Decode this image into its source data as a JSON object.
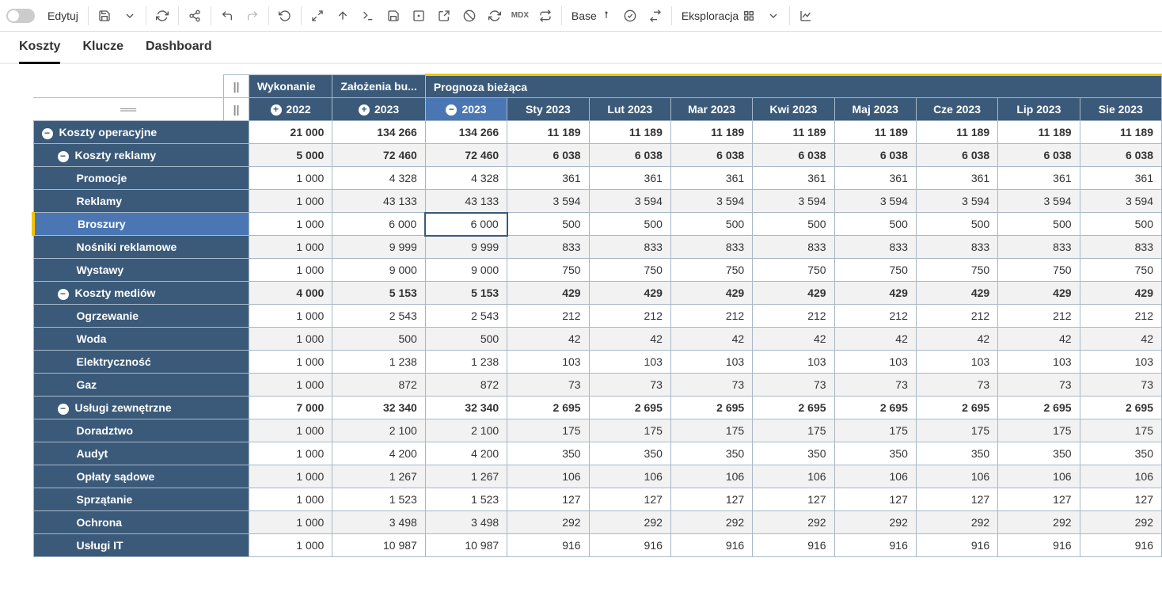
{
  "toolbar": {
    "edit_label": "Edytuj",
    "base_label": "Base",
    "exploration_label": "Eksploracja",
    "mdx_label": "MDX"
  },
  "tabs": [
    {
      "label": "Koszty",
      "active": true
    },
    {
      "label": "Klucze",
      "active": false
    },
    {
      "label": "Dashboard",
      "active": false
    }
  ],
  "pause_glyph": "||",
  "handle_glyph": "══",
  "top_headers": [
    {
      "label": "Wykonanie",
      "pm": null,
      "selected": false
    },
    {
      "label": "Założenia bu...",
      "pm": null,
      "selected": false
    },
    {
      "label": "Prognoza bieżąca",
      "pm": null,
      "selected": true,
      "span": 9
    }
  ],
  "sub_headers": [
    {
      "label": "2022",
      "pm": "+",
      "selected": false
    },
    {
      "label": "2023",
      "pm": "+",
      "selected": false
    },
    {
      "label": "2023",
      "pm": "−",
      "selected": true
    },
    {
      "label": "Sty 2023",
      "pm": null
    },
    {
      "label": "Lut 2023",
      "pm": null
    },
    {
      "label": "Mar 2023",
      "pm": null
    },
    {
      "label": "Kwi 2023",
      "pm": null
    },
    {
      "label": "Maj 2023",
      "pm": null
    },
    {
      "label": "Cze 2023",
      "pm": null
    },
    {
      "label": "Lip 2023",
      "pm": null
    },
    {
      "label": "Sie 2023",
      "pm": null
    }
  ],
  "rows": [
    {
      "label": "Koszty operacyjne",
      "indent": 0,
      "pm": "−",
      "bold": true,
      "alt": false,
      "vals": [
        "21 000",
        "134 266",
        "134 266",
        "11 189",
        "11 189",
        "11 189",
        "11 189",
        "11 189",
        "11 189",
        "11 189",
        "11 189"
      ]
    },
    {
      "label": "Koszty reklamy",
      "indent": 1,
      "pm": "−",
      "bold": true,
      "alt": true,
      "vals": [
        "5 000",
        "72 460",
        "72 460",
        "6 038",
        "6 038",
        "6 038",
        "6 038",
        "6 038",
        "6 038",
        "6 038",
        "6 038"
      ]
    },
    {
      "label": "Promocje",
      "indent": 2,
      "pm": null,
      "bold": false,
      "alt": false,
      "vals": [
        "1 000",
        "4 328",
        "4 328",
        "361",
        "361",
        "361",
        "361",
        "361",
        "361",
        "361",
        "361"
      ]
    },
    {
      "label": "Reklamy",
      "indent": 2,
      "pm": null,
      "bold": false,
      "alt": true,
      "vals": [
        "1 000",
        "43 133",
        "43 133",
        "3 594",
        "3 594",
        "3 594",
        "3 594",
        "3 594",
        "3 594",
        "3 594",
        "3 594"
      ]
    },
    {
      "label": "Broszury",
      "indent": 2,
      "pm": null,
      "bold": false,
      "alt": false,
      "selected": true,
      "selcol": 2,
      "vals": [
        "1 000",
        "6 000",
        "6 000",
        "500",
        "500",
        "500",
        "500",
        "500",
        "500",
        "500",
        "500"
      ]
    },
    {
      "label": "Nośniki reklamowe",
      "indent": 2,
      "pm": null,
      "bold": false,
      "alt": true,
      "vals": [
        "1 000",
        "9 999",
        "9 999",
        "833",
        "833",
        "833",
        "833",
        "833",
        "833",
        "833",
        "833"
      ]
    },
    {
      "label": "Wystawy",
      "indent": 2,
      "pm": null,
      "bold": false,
      "alt": false,
      "vals": [
        "1 000",
        "9 000",
        "9 000",
        "750",
        "750",
        "750",
        "750",
        "750",
        "750",
        "750",
        "750"
      ]
    },
    {
      "label": "Koszty mediów",
      "indent": 1,
      "pm": "−",
      "bold": true,
      "alt": true,
      "vals": [
        "4 000",
        "5 153",
        "5 153",
        "429",
        "429",
        "429",
        "429",
        "429",
        "429",
        "429",
        "429"
      ]
    },
    {
      "label": "Ogrzewanie",
      "indent": 2,
      "pm": null,
      "bold": false,
      "alt": false,
      "vals": [
        "1 000",
        "2 543",
        "2 543",
        "212",
        "212",
        "212",
        "212",
        "212",
        "212",
        "212",
        "212"
      ]
    },
    {
      "label": "Woda",
      "indent": 2,
      "pm": null,
      "bold": false,
      "alt": true,
      "vals": [
        "1 000",
        "500",
        "500",
        "42",
        "42",
        "42",
        "42",
        "42",
        "42",
        "42",
        "42"
      ]
    },
    {
      "label": "Elektryczność",
      "indent": 2,
      "pm": null,
      "bold": false,
      "alt": false,
      "vals": [
        "1 000",
        "1 238",
        "1 238",
        "103",
        "103",
        "103",
        "103",
        "103",
        "103",
        "103",
        "103"
      ]
    },
    {
      "label": "Gaz",
      "indent": 2,
      "pm": null,
      "bold": false,
      "alt": true,
      "vals": [
        "1 000",
        "872",
        "872",
        "73",
        "73",
        "73",
        "73",
        "73",
        "73",
        "73",
        "73"
      ]
    },
    {
      "label": "Usługi zewnętrzne",
      "indent": 1,
      "pm": "−",
      "bold": true,
      "alt": false,
      "vals": [
        "7 000",
        "32 340",
        "32 340",
        "2 695",
        "2 695",
        "2 695",
        "2 695",
        "2 695",
        "2 695",
        "2 695",
        "2 695"
      ]
    },
    {
      "label": "Doradztwo",
      "indent": 2,
      "pm": null,
      "bold": false,
      "alt": true,
      "vals": [
        "1 000",
        "2 100",
        "2 100",
        "175",
        "175",
        "175",
        "175",
        "175",
        "175",
        "175",
        "175"
      ]
    },
    {
      "label": "Audyt",
      "indent": 2,
      "pm": null,
      "bold": false,
      "alt": false,
      "vals": [
        "1 000",
        "4 200",
        "4 200",
        "350",
        "350",
        "350",
        "350",
        "350",
        "350",
        "350",
        "350"
      ]
    },
    {
      "label": "Opłaty sądowe",
      "indent": 2,
      "pm": null,
      "bold": false,
      "alt": true,
      "vals": [
        "1 000",
        "1 267",
        "1 267",
        "106",
        "106",
        "106",
        "106",
        "106",
        "106",
        "106",
        "106"
      ]
    },
    {
      "label": "Sprzątanie",
      "indent": 2,
      "pm": null,
      "bold": false,
      "alt": false,
      "vals": [
        "1 000",
        "1 523",
        "1 523",
        "127",
        "127",
        "127",
        "127",
        "127",
        "127",
        "127",
        "127"
      ]
    },
    {
      "label": "Ochrona",
      "indent": 2,
      "pm": null,
      "bold": false,
      "alt": true,
      "vals": [
        "1 000",
        "3 498",
        "3 498",
        "292",
        "292",
        "292",
        "292",
        "292",
        "292",
        "292",
        "292"
      ]
    },
    {
      "label": "Usługi IT",
      "indent": 2,
      "pm": null,
      "bold": false,
      "alt": false,
      "vals": [
        "1 000",
        "10 987",
        "10 987",
        "916",
        "916",
        "916",
        "916",
        "916",
        "916",
        "916",
        "916"
      ]
    }
  ]
}
